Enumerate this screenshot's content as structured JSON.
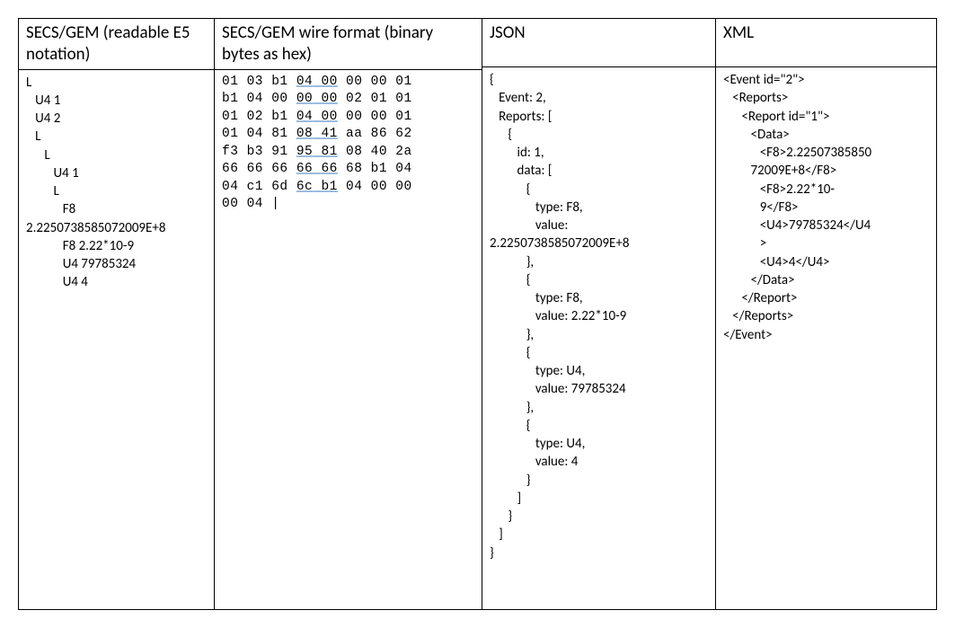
{
  "columns": {
    "c1": {
      "header": "SECS/GEM\n(readable E5 notation)",
      "body": "L\n   U4 1\n   U4 2\n   L\n      L\n         U4 1\n         L\n            F8\n2.2250738585072009E+8\n            F8 2.22*10-9\n            U4 79785324\n            U4 4"
    },
    "c2": {
      "header": "SECS/GEM wire format\n(binary bytes as hex)",
      "hex_rows": [
        [
          "01",
          "03",
          "b1",
          "04",
          "00",
          "00",
          "00",
          "01"
        ],
        [
          "b1",
          "04",
          "00",
          "00",
          "00",
          "02",
          "01",
          "01"
        ],
        [
          "01",
          "02",
          "b1",
          "04",
          "00",
          "00",
          "00",
          "01"
        ],
        [
          "01",
          "04",
          "81",
          "08",
          "41",
          "aa",
          "86",
          "62"
        ],
        [
          "f3",
          "b3",
          "91",
          "95",
          "81",
          "08",
          "40",
          "2a"
        ],
        [
          "66",
          "66",
          "66",
          "66",
          "66",
          "68",
          "b1",
          "04"
        ],
        [
          "04",
          "c1",
          "6d",
          "6c",
          "b1",
          "04",
          "00",
          "00"
        ],
        [
          "00",
          "04",
          "|"
        ]
      ],
      "underlined_positions": {
        "0": [
          3,
          4
        ],
        "1": [
          3,
          4
        ],
        "2": [
          3,
          4
        ],
        "3": [
          3,
          4
        ],
        "4": [
          3,
          4
        ],
        "5": [
          3,
          4
        ],
        "6": [
          3,
          4
        ]
      }
    },
    "c3": {
      "header": "JSON",
      "body": "{\n   Event: 2,\n   Reports: [\n      {\n         id: 1,\n         data: [\n            {\n               type: F8,\n               value:\n2.2250738585072009E+8\n            },\n            {\n               type: F8,\n               value: 2.22*10-9\n            },\n            {\n               type: U4,\n               value: 79785324\n            },\n            {\n               type: U4,\n               value: 4\n            }\n         ]\n      }\n   ]\n}"
    },
    "c4": {
      "header": "XML",
      "body": "<Event id=\"2\">\n   <Reports>\n      <Report id=\"1\">\n         <Data>\n            <F8>2.22507385850\n         72009E+8</F8>\n            <F8>2.22*10-\n            9</F8>\n            <U4>79785324</U4\n            >\n            <U4>4</U4>\n         </Data>\n      </Report>\n   </Reports>\n</Event>"
    }
  }
}
